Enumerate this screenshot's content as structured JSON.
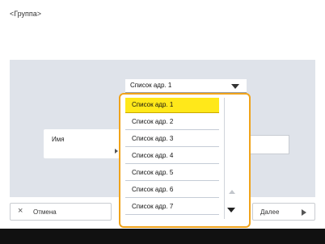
{
  "header": {
    "title": "<Группа>"
  },
  "address_select": {
    "value": "Список адр. 1"
  },
  "form": {
    "name_label": "Имя"
  },
  "dropdown": {
    "options": [
      {
        "label": "Список адр. 1",
        "selected": true
      },
      {
        "label": "Список адр. 2"
      },
      {
        "label": "Список адр. 3"
      },
      {
        "label": "Список адр. 4"
      },
      {
        "label": "Список адр. 5"
      },
      {
        "label": "Список адр. 6"
      },
      {
        "label": "Список адр. 7"
      }
    ]
  },
  "footer": {
    "cancel_label": "Отмена",
    "next_label": "Далее"
  },
  "colors": {
    "highlight": "#ffe81a",
    "focus_border": "#f0a31a",
    "panel": "#dfe3ea"
  },
  "icons": {
    "close": "×",
    "next": "right-triangle-icon",
    "scroll_up": "up-triangle-icon",
    "scroll_down": "down-triangle-icon"
  }
}
